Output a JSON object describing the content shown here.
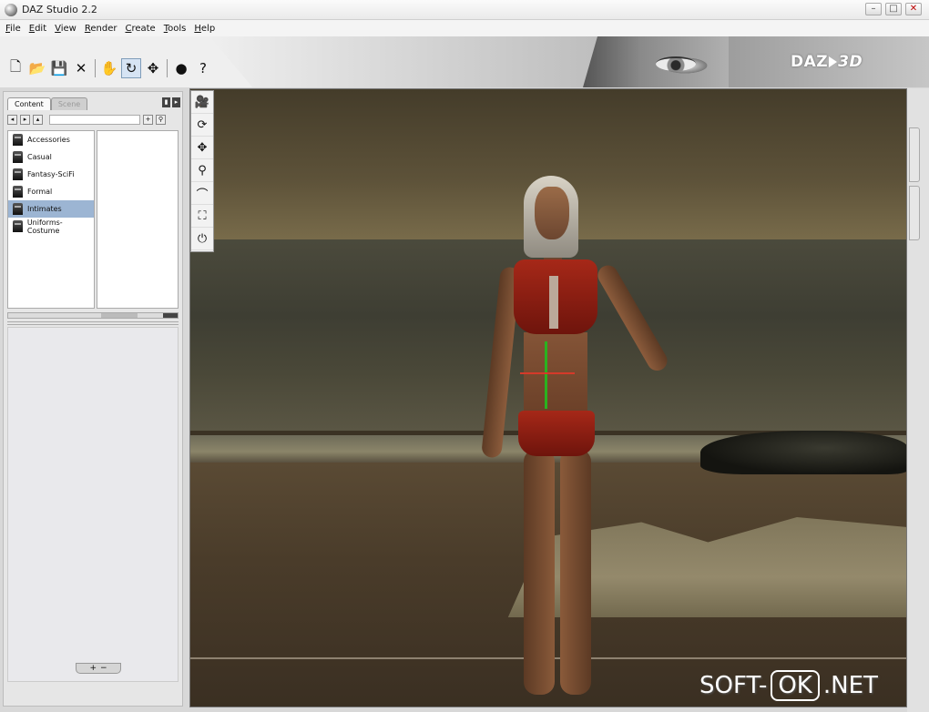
{
  "window": {
    "title": "DAZ Studio 2.2"
  },
  "menu": [
    "File",
    "Edit",
    "View",
    "Render",
    "Create",
    "Tools",
    "Help"
  ],
  "toolbar": {
    "tools": [
      {
        "name": "new-file-icon",
        "glyph": "🗋"
      },
      {
        "name": "open-folder-icon",
        "glyph": "📂"
      },
      {
        "name": "save-icon",
        "glyph": "💾"
      },
      {
        "name": "close-x-icon",
        "glyph": "✕"
      },
      {
        "name": "node-select-icon",
        "glyph": "✋"
      },
      {
        "name": "rotate-icon",
        "glyph": "↻"
      },
      {
        "name": "translate-icon",
        "glyph": "✥"
      },
      {
        "name": "render-sphere-icon",
        "glyph": "●"
      },
      {
        "name": "help-icon",
        "glyph": "?"
      }
    ],
    "active_tool_index": 5
  },
  "banner": {
    "logo_prefix": "DAZ",
    "logo_suffix": "3D"
  },
  "left_panel": {
    "tabs": [
      {
        "label": "Content",
        "active": true
      },
      {
        "label": "Scene",
        "active": false
      }
    ],
    "folders": [
      {
        "label": "Accessories",
        "selected": false
      },
      {
        "label": "Casual",
        "selected": false
      },
      {
        "label": "Fantasy-SciFi",
        "selected": false
      },
      {
        "label": "Formal",
        "selected": false
      },
      {
        "label": "Intimates",
        "selected": true
      },
      {
        "label": "Uniforms-Costume",
        "selected": false
      }
    ],
    "bottom_buttons": [
      "+",
      "−"
    ]
  },
  "viewport_tools": [
    {
      "name": "camera-icon",
      "glyph": "🎥"
    },
    {
      "name": "orbit-icon",
      "glyph": "⟳"
    },
    {
      "name": "pan-icon",
      "glyph": "✥"
    },
    {
      "name": "zoom-icon",
      "glyph": "⚲"
    },
    {
      "name": "dolly-icon",
      "glyph": "⌒"
    },
    {
      "name": "frame-icon",
      "glyph": "⛶"
    },
    {
      "name": "reset-view-icon",
      "glyph": "⏻"
    }
  ],
  "watermark": {
    "prefix": "SOFT-",
    "boxed": "OK",
    "suffix": ".NET"
  }
}
